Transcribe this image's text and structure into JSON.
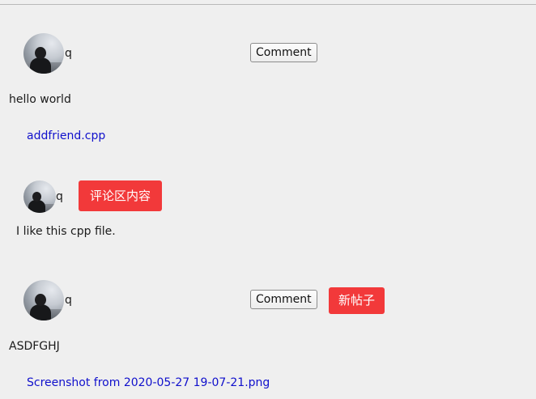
{
  "posts": [
    {
      "username": "q",
      "comment_button": "Comment",
      "content": "hello world",
      "attachment": "addfriend.cpp"
    },
    {
      "username": "q",
      "comment_button": "Comment",
      "content": "ASDFGHJ",
      "attachment": "Screenshot from 2020-05-27 19-07-21.png",
      "badge": "新帖子"
    }
  ],
  "comment": {
    "username": "q",
    "badge": "评论区内容",
    "content": "I like this cpp file."
  },
  "colors": {
    "badge_red": "#f2393a",
    "link_blue": "#1010cc",
    "background": "#efefef"
  },
  "icons": {
    "avatar": "user-avatar-photo"
  }
}
